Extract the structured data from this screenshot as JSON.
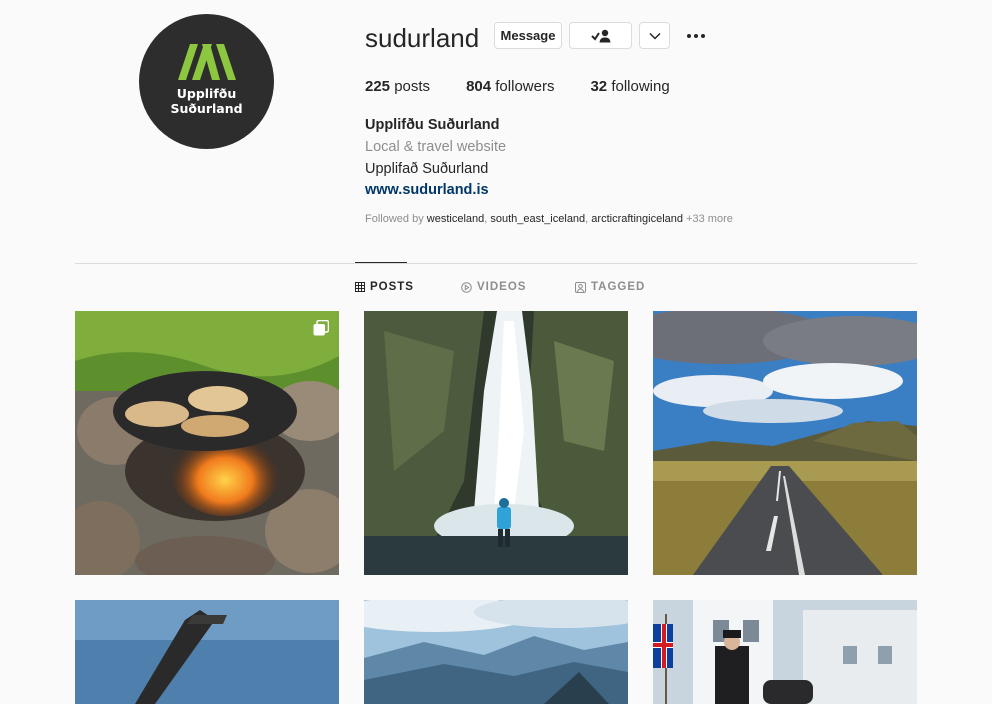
{
  "profile": {
    "username": "sudurland",
    "avatar_text_line1": "Upplifðu",
    "avatar_text_line2": "Suðurland",
    "brand_green": "#8dc63f"
  },
  "actions": {
    "message_label": "Message",
    "follow_icon": "person-check-icon",
    "dropdown_icon": "chevron-down-icon",
    "more_icon": "more-dots-icon"
  },
  "stats": [
    {
      "count": "225",
      "label": "posts"
    },
    {
      "count": "804",
      "label": "followers"
    },
    {
      "count": "32",
      "label": "following"
    }
  ],
  "bio": {
    "name": "Upplifðu Suðurland",
    "category": "Local & travel website",
    "text": "Upplifað Suðurland",
    "link": "www.sudurland.is"
  },
  "followed_by": {
    "prefix": "Followed by",
    "accounts": [
      "westiceland",
      "south_east_iceland",
      "arcticraftingiceland"
    ],
    "more": "+33 more"
  },
  "tabs": [
    {
      "label": "POSTS",
      "icon": "grid-icon",
      "active": true
    },
    {
      "label": "VIDEOS",
      "icon": "play-icon",
      "active": false
    },
    {
      "label": "TAGGED",
      "icon": "tagged-icon",
      "active": false
    }
  ],
  "posts": [
    {
      "subject": "flatbread cooking on griddle over campfire",
      "multi": true
    },
    {
      "subject": "waterfall in canyon with person in blue jacket",
      "multi": false
    },
    {
      "subject": "road through landscape under blue cloudy sky",
      "multi": false
    },
    {
      "subject": "sculpture against blue sky",
      "multi": false
    },
    {
      "subject": "mountain landscape view",
      "multi": false
    },
    {
      "subject": "rider with Icelandic flag by white house",
      "multi": false
    }
  ]
}
